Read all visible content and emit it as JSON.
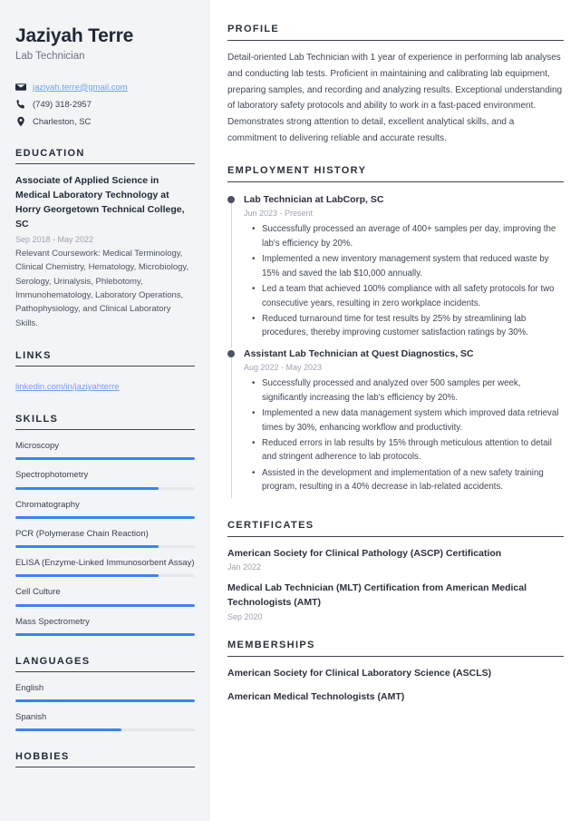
{
  "colors": {
    "sidebar_bg": "#f3f4f6",
    "accent_blue": "#3b82f6",
    "link_blue": "#6aa4f7",
    "heading": "#1f2937",
    "body_text": "#3f4654",
    "muted": "#9ca3af",
    "bar_track": "#e5e7eb",
    "timeline_dot": "#4b5265"
  },
  "sidebar": {
    "name": "Jaziyah Terre",
    "job_title": "Lab Technician",
    "contact": [
      {
        "icon": "envelope-icon",
        "text": "jaziyah.terre@gmail.com",
        "is_link": true
      },
      {
        "icon": "phone-icon",
        "text": "(749) 318-2957",
        "is_link": false
      },
      {
        "icon": "location-pin-icon",
        "text": "Charleston, SC",
        "is_link": false
      }
    ],
    "education": {
      "heading": "EDUCATION",
      "degree": "Associate of Applied Science in Medical Laboratory Technology at Horry Georgetown Technical College, SC",
      "date": "Sep 2018 - May 2022",
      "description": "Relevant Coursework: Medical Terminology, Clinical Chemistry, Hematology, Microbiology, Serology, Urinalysis, Phlebotomy, Immunohematology, Laboratory Operations, Pathophysiology, and Clinical Laboratory Skills."
    },
    "links": {
      "heading": "LINKS",
      "items": [
        {
          "label": "linkedin.com/in/jaziyahterre"
        }
      ]
    },
    "skills": {
      "heading": "SKILLS",
      "items": [
        {
          "label": "Microscopy",
          "level": 100
        },
        {
          "label": "Spectrophotometry",
          "level": 80
        },
        {
          "label": "Chromatography",
          "level": 100
        },
        {
          "label": "PCR (Polymerase Chain Reaction)",
          "level": 80
        },
        {
          "label": "ELISA (Enzyme-Linked Immunosorbent Assay)",
          "level": 80
        },
        {
          "label": "Cell Culture",
          "level": 100
        },
        {
          "label": "Mass Spectrometry",
          "level": 100
        }
      ]
    },
    "languages": {
      "heading": "LANGUAGES",
      "items": [
        {
          "label": "English",
          "level": 100
        },
        {
          "label": "Spanish",
          "level": 59
        }
      ]
    },
    "hobbies": {
      "heading": "HOBBIES"
    }
  },
  "main": {
    "profile": {
      "heading": "PROFILE",
      "text": "Detail-oriented Lab Technician with 1 year of experience in performing lab analyses and conducting lab tests. Proficient in maintaining and calibrating lab equipment, preparing samples, and recording and analyzing results. Exceptional understanding of laboratory safety protocols and ability to work in a fast-paced environment. Demonstrates strong attention to detail, excellent analytical skills, and a commitment to delivering reliable and accurate results."
    },
    "employment": {
      "heading": "EMPLOYMENT HISTORY",
      "items": [
        {
          "role": "Lab Technician at LabCorp, SC",
          "date": "Jun 2023 - Present",
          "bullets": [
            "Successfully processed an average of 400+ samples per day, improving the lab's efficiency by 20%.",
            "Implemented a new inventory management system that reduced waste by 15% and saved the lab $10,000 annually.",
            "Led a team that achieved 100% compliance with all safety protocols for two consecutive years, resulting in zero workplace incidents.",
            "Reduced turnaround time for test results by 25% by streamlining lab procedures, thereby improving customer satisfaction ratings by 30%."
          ]
        },
        {
          "role": "Assistant Lab Technician at Quest Diagnostics, SC",
          "date": "Aug 2022 - May 2023",
          "bullets": [
            "Successfully processed and analyzed over 500 samples per week, significantly increasing the lab's efficiency by 20%.",
            "Implemented a new data management system which improved data retrieval times by 30%, enhancing workflow and productivity.",
            "Reduced errors in lab results by 15% through meticulous attention to detail and stringent adherence to lab protocols.",
            "Assisted in the development and implementation of a new safety training program, resulting in a 40% decrease in lab-related accidents."
          ]
        }
      ]
    },
    "certificates": {
      "heading": "CERTIFICATES",
      "items": [
        {
          "name": "American Society for Clinical Pathology (ASCP) Certification",
          "date": "Jan 2022"
        },
        {
          "name": "Medical Lab Technician (MLT) Certification from American Medical Technologists (AMT)",
          "date": "Sep 2020"
        }
      ]
    },
    "memberships": {
      "heading": "MEMBERSHIPS",
      "items": [
        {
          "name": "American Society for Clinical Laboratory Science (ASCLS)"
        },
        {
          "name": "American Medical Technologists (AMT)"
        }
      ]
    }
  }
}
